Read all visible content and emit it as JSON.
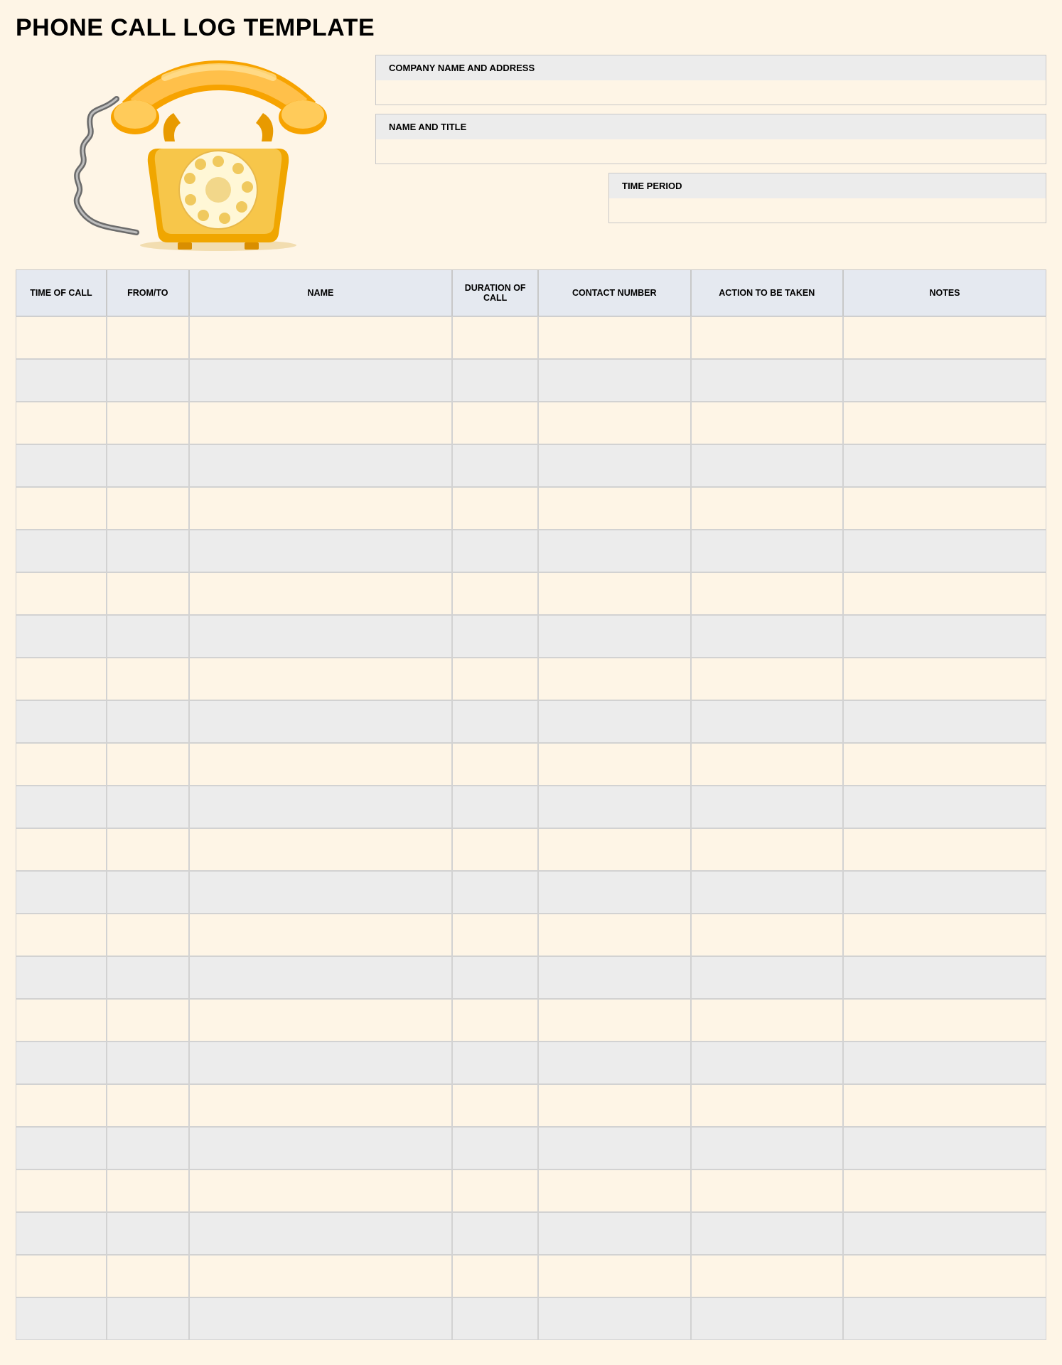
{
  "title": "PHONE CALL LOG TEMPLATE",
  "meta": {
    "company_label": "COMPANY NAME AND ADDRESS",
    "company_value": "",
    "nametitle_label": "NAME AND TITLE",
    "nametitle_value": "",
    "timeperiod_label": "TIME PERIOD",
    "timeperiod_value": ""
  },
  "columns": [
    "TIME OF CALL",
    "FROM/TO",
    "NAME",
    "DURATION OF CALL",
    "CONTACT NUMBER",
    "ACTION TO BE TAKEN",
    "NOTES"
  ],
  "rows": [
    {
      "time": "",
      "fromto": "",
      "name": "",
      "duration": "",
      "contact": "",
      "action": "",
      "notes": ""
    },
    {
      "time": "",
      "fromto": "",
      "name": "",
      "duration": "",
      "contact": "",
      "action": "",
      "notes": ""
    },
    {
      "time": "",
      "fromto": "",
      "name": "",
      "duration": "",
      "contact": "",
      "action": "",
      "notes": ""
    },
    {
      "time": "",
      "fromto": "",
      "name": "",
      "duration": "",
      "contact": "",
      "action": "",
      "notes": ""
    },
    {
      "time": "",
      "fromto": "",
      "name": "",
      "duration": "",
      "contact": "",
      "action": "",
      "notes": ""
    },
    {
      "time": "",
      "fromto": "",
      "name": "",
      "duration": "",
      "contact": "",
      "action": "",
      "notes": ""
    },
    {
      "time": "",
      "fromto": "",
      "name": "",
      "duration": "",
      "contact": "",
      "action": "",
      "notes": ""
    },
    {
      "time": "",
      "fromto": "",
      "name": "",
      "duration": "",
      "contact": "",
      "action": "",
      "notes": ""
    },
    {
      "time": "",
      "fromto": "",
      "name": "",
      "duration": "",
      "contact": "",
      "action": "",
      "notes": ""
    },
    {
      "time": "",
      "fromto": "",
      "name": "",
      "duration": "",
      "contact": "",
      "action": "",
      "notes": ""
    },
    {
      "time": "",
      "fromto": "",
      "name": "",
      "duration": "",
      "contact": "",
      "action": "",
      "notes": ""
    },
    {
      "time": "",
      "fromto": "",
      "name": "",
      "duration": "",
      "contact": "",
      "action": "",
      "notes": ""
    },
    {
      "time": "",
      "fromto": "",
      "name": "",
      "duration": "",
      "contact": "",
      "action": "",
      "notes": ""
    },
    {
      "time": "",
      "fromto": "",
      "name": "",
      "duration": "",
      "contact": "",
      "action": "",
      "notes": ""
    },
    {
      "time": "",
      "fromto": "",
      "name": "",
      "duration": "",
      "contact": "",
      "action": "",
      "notes": ""
    },
    {
      "time": "",
      "fromto": "",
      "name": "",
      "duration": "",
      "contact": "",
      "action": "",
      "notes": ""
    },
    {
      "time": "",
      "fromto": "",
      "name": "",
      "duration": "",
      "contact": "",
      "action": "",
      "notes": ""
    },
    {
      "time": "",
      "fromto": "",
      "name": "",
      "duration": "",
      "contact": "",
      "action": "",
      "notes": ""
    },
    {
      "time": "",
      "fromto": "",
      "name": "",
      "duration": "",
      "contact": "",
      "action": "",
      "notes": ""
    },
    {
      "time": "",
      "fromto": "",
      "name": "",
      "duration": "",
      "contact": "",
      "action": "",
      "notes": ""
    },
    {
      "time": "",
      "fromto": "",
      "name": "",
      "duration": "",
      "contact": "",
      "action": "",
      "notes": ""
    },
    {
      "time": "",
      "fromto": "",
      "name": "",
      "duration": "",
      "contact": "",
      "action": "",
      "notes": ""
    },
    {
      "time": "",
      "fromto": "",
      "name": "",
      "duration": "",
      "contact": "",
      "action": "",
      "notes": ""
    },
    {
      "time": "",
      "fromto": "",
      "name": "",
      "duration": "",
      "contact": "",
      "action": "",
      "notes": ""
    }
  ]
}
